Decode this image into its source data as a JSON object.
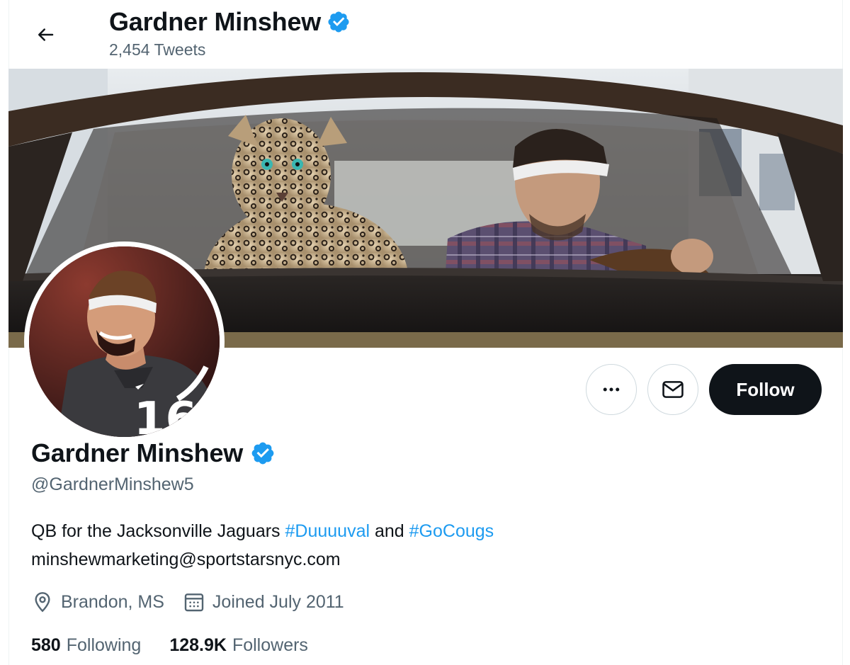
{
  "header": {
    "name": "Gardner Minshew",
    "tweet_count": "2,454 Tweets"
  },
  "profile": {
    "name": "Gardner Minshew",
    "handle": "@GardnerMinshew5",
    "bio_text": "QB for the Jacksonville Jaguars ",
    "hashtag1": "#Duuuuval",
    "bio_and": " and ",
    "hashtag2": "#GoCougs",
    "bio_email": "minshewmarketing@sportstarsnyc.com",
    "location": "Brandon, MS",
    "joined": "Joined July 2011",
    "following_count": "580",
    "following_label": "Following",
    "followers_count": "128.9K",
    "followers_label": "Followers",
    "jersey_number": "16"
  },
  "actions": {
    "follow_label": "Follow"
  },
  "icons": {
    "back": "arrow-left-icon",
    "verified": "verified-badge-icon",
    "more": "more-horizontal-icon",
    "message": "envelope-icon",
    "location": "location-pin-icon",
    "calendar": "calendar-icon"
  },
  "colors": {
    "accent": "#1d9bf0",
    "text_primary": "#0f1419",
    "text_secondary": "#536471",
    "follow_button": "#0f1419"
  }
}
